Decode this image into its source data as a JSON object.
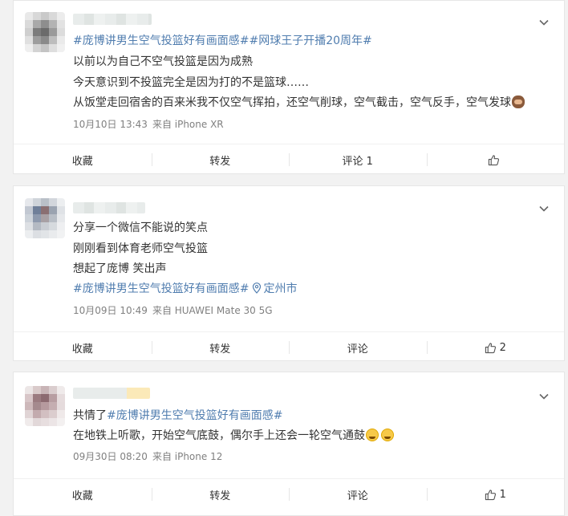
{
  "posts": [
    {
      "lines": [
        {
          "topics": [
            "#庞博讲男生空气投篮好有画面感#",
            "#网球王子开播20周年#"
          ],
          "text": ""
        },
        {
          "text": "以前以为自己不空气投篮是因为成熟"
        },
        {
          "text": "今天意识到不投篮完全是因为打的不是篮球……"
        },
        {
          "text": "从饭堂走回宿舍的百来米我不仅空气挥拍，还空气削球，空气截击，空气反手，空气发球"
        }
      ],
      "date": "10月10日 13:43",
      "source": "来自 iPhone XR",
      "actions": {
        "collect": "收藏",
        "repost": "转发",
        "comment": "评论 1",
        "like": ""
      }
    },
    {
      "lines": [
        {
          "text": "分享一个微信不能说的笑点"
        },
        {
          "text": "刚刚看到体育老师空气投篮"
        },
        {
          "text": "想起了庞博 笑出声"
        }
      ],
      "topic_line": {
        "topic": "#庞博讲男生空气投篮好有画面感#",
        "location": "定州市"
      },
      "date": "10月09日 10:49",
      "source": "来自 HUAWEI Mate 30 5G",
      "actions": {
        "collect": "收藏",
        "repost": "转发",
        "comment": "评论",
        "like": "2"
      }
    },
    {
      "first_line": {
        "prefix": "共情了",
        "topic": "#庞博讲男生空气投篮好有画面感#"
      },
      "lines": [
        {
          "text": "在地铁上听歌，开始空气底鼓，偶尔手上还会一轮空气通鼓"
        }
      ],
      "date": "09月30日 08:20",
      "source": "来自 iPhone 12",
      "actions": {
        "collect": "收藏",
        "repost": "转发",
        "comment": "评论",
        "like": "1"
      }
    }
  ],
  "colors": {
    "topic": "#507daf",
    "meta": "#808080",
    "text": "#333333",
    "background": "#f2f2f2"
  },
  "icons": [
    "chevron-down-icon",
    "thumbs-up-icon",
    "location-pin-icon",
    "monkey-emoji",
    "sweat-smile-emoji"
  ]
}
